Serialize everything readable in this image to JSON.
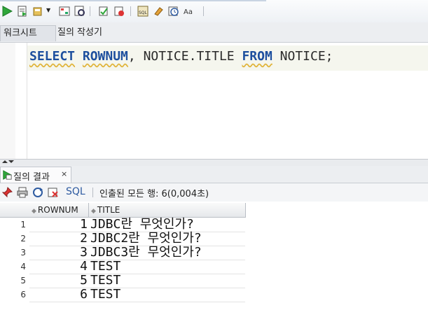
{
  "worksheet_tabs": [
    {
      "label": "워크시트"
    },
    {
      "label": "질의 작성기"
    }
  ],
  "editor": {
    "sql_tokens": [
      {
        "text": "SELECT",
        "type": "keyword"
      },
      {
        "text": " ",
        "type": "space"
      },
      {
        "text": "ROWNUM",
        "type": "keyword"
      },
      {
        "text": ", NOTICE.TITLE ",
        "type": "ident"
      },
      {
        "text": "FROM",
        "type": "keyword"
      },
      {
        "text": " NOTICE;",
        "type": "ident"
      }
    ]
  },
  "results_panel": {
    "tab_label": "질의 결과",
    "tab_close": "×",
    "toolbar_sql": "SQL",
    "status": "인출된 모든 행: 6(0,004초)"
  },
  "grid": {
    "columns": [
      "ROWNUM",
      "TITLE"
    ],
    "rows": [
      {
        "n": "1",
        "rownum": "1",
        "title": "JDBC란 무엇인가?"
      },
      {
        "n": "2",
        "rownum": "2",
        "title": "JDBC2란 무엇인가?"
      },
      {
        "n": "3",
        "rownum": "3",
        "title": "JDBC3란 무엇인가?"
      },
      {
        "n": "4",
        "rownum": "4",
        "title": "TEST"
      },
      {
        "n": "5",
        "rownum": "5",
        "title": "TEST"
      },
      {
        "n": "6",
        "rownum": "6",
        "title": "TEST"
      }
    ]
  },
  "colors": {
    "keyword": "#1d4f9e",
    "sql_label": "#2d5aa0",
    "accent_green": "#2fa63a"
  }
}
